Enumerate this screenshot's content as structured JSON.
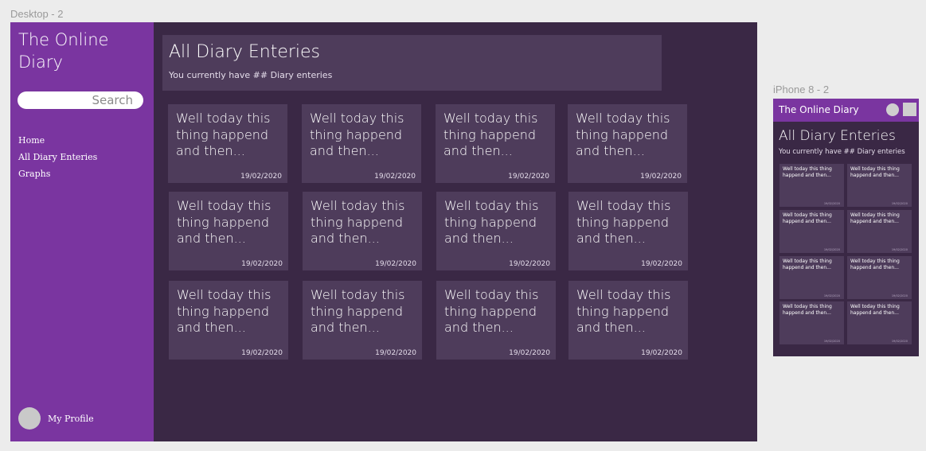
{
  "frames": {
    "desktop_label": "Desktop - 2",
    "phone_label": "iPhone 8 - 2"
  },
  "colors": {
    "sidebar": "#7a35a0",
    "background": "#3a2845",
    "card": "#4e3c5b",
    "text": "#ffffff"
  },
  "sidebar": {
    "title": "The Online Diary",
    "search_placeholder": "Search",
    "nav": [
      {
        "label": "Home"
      },
      {
        "label": "All Diary Enteries"
      },
      {
        "label": "Graphs"
      }
    ],
    "profile_label": "My Profile"
  },
  "header": {
    "title": "All Diary Enteries",
    "subtitle": "You currently have ## Diary enteries"
  },
  "entries": [
    {
      "text": "Well today this thing happend and then...",
      "date": "19/02/2020"
    },
    {
      "text": "Well today this thing happend and then...",
      "date": "19/02/2020"
    },
    {
      "text": "Well today this thing happend and then...",
      "date": "19/02/2020"
    },
    {
      "text": "Well today this thing happend and then...",
      "date": "19/02/2020"
    },
    {
      "text": "Well today this thing happend and then...",
      "date": "19/02/2020"
    },
    {
      "text": "Well today this thing happend and then...",
      "date": "19/02/2020"
    },
    {
      "text": "Well today this thing happend and then...",
      "date": "19/02/2020"
    },
    {
      "text": "Well today this thing happend and then...",
      "date": "19/02/2020"
    },
    {
      "text": "Well today this thing happend and then...",
      "date": "19/02/2020"
    },
    {
      "text": "Well today this thing happend and then...",
      "date": "19/02/2020"
    },
    {
      "text": "Well today this thing happend and then...",
      "date": "19/02/2020"
    },
    {
      "text": "Well today this thing happend and then...",
      "date": "19/02/2020"
    }
  ],
  "phone": {
    "app_title": "The Online Diary",
    "title": "All Diary Enteries",
    "subtitle": "You currently have ## Diary enteries",
    "icons": [
      "profile-dot-icon",
      "menu-square-icon"
    ],
    "entries": [
      {
        "text": "Well today this thing happend and then...",
        "date": "19/02/2020"
      },
      {
        "text": "Well today this thing happend and then...",
        "date": "19/02/2020"
      },
      {
        "text": "Well today this thing happend and then...",
        "date": "19/02/2020"
      },
      {
        "text": "Well today this thing happend and then...",
        "date": "19/02/2020"
      },
      {
        "text": "Well today this thing happend and then...",
        "date": "19/02/2020"
      },
      {
        "text": "Well today this thing happend and then...",
        "date": "19/02/2020"
      },
      {
        "text": "Well today this thing happend and then...",
        "date": "19/02/2020"
      },
      {
        "text": "Well today this thing happend and then...",
        "date": "19/02/2020"
      }
    ]
  }
}
